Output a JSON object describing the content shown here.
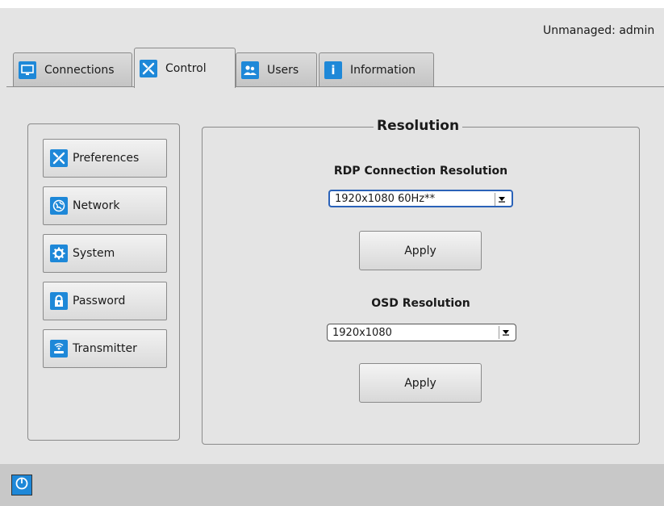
{
  "header": {
    "status": "Unmanaged: admin"
  },
  "tabs": [
    {
      "label": "Connections",
      "icon": "monitor-icon"
    },
    {
      "label": "Control",
      "icon": "tools-icon",
      "active": true
    },
    {
      "label": "Users",
      "icon": "users-icon"
    },
    {
      "label": "Information",
      "icon": "info-icon"
    }
  ],
  "sidebar": {
    "items": [
      {
        "label": "Preferences",
        "icon": "tools-icon"
      },
      {
        "label": "Network",
        "icon": "globe-icon"
      },
      {
        "label": "System",
        "icon": "gear-icon"
      },
      {
        "label": "Password",
        "icon": "lock-icon"
      },
      {
        "label": "Transmitter",
        "icon": "transmitter-icon"
      }
    ]
  },
  "resolution": {
    "title": "Resolution",
    "rdp_label": "RDP Connection Resolution",
    "rdp_value": "1920x1080 60Hz**",
    "apply_label": "Apply",
    "osd_label": "OSD Resolution",
    "osd_value": "1920x1080",
    "osd_apply_label": "Apply"
  },
  "colors": {
    "accent": "#1e88d8",
    "background": "#e4e4e4",
    "bottom_bar": "#c8c8c8"
  }
}
